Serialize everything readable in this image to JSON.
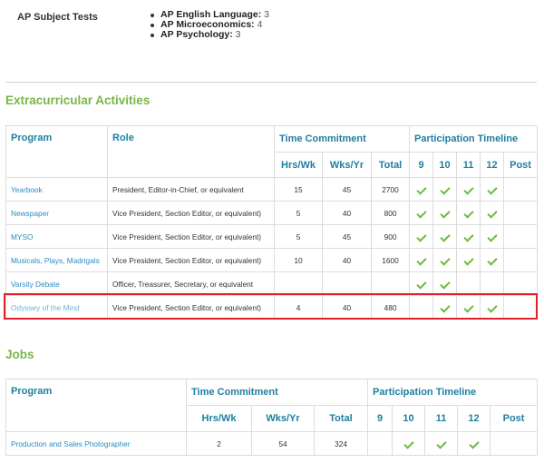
{
  "ap": {
    "label": "AP Subject Tests",
    "tests": [
      {
        "name": "AP English Language:",
        "score": "3"
      },
      {
        "name": "AP Microeconomics:",
        "score": "4"
      },
      {
        "name": "AP Psychology:",
        "score": "3"
      }
    ]
  },
  "extracurricular": {
    "title": "Extracurricular Activities",
    "headers": {
      "program": "Program",
      "role": "Role",
      "time": "Time Commitment",
      "timeline": "Participation Timeline",
      "hrs": "Hrs/Wk",
      "wks": "Wks/Yr",
      "total": "Total",
      "g9": "9",
      "g10": "10",
      "g11": "11",
      "g12": "12",
      "post": "Post"
    },
    "rows": [
      {
        "program": "Yearbook",
        "role": "President, Editor-in-Chief, or equivalent",
        "hrs": "15",
        "wks": "45",
        "total": "2700"
      },
      {
        "program": "Newspaper",
        "role": "Vice President, Section Editor, or equivalent)",
        "hrs": "5",
        "wks": "40",
        "total": "800"
      },
      {
        "program": "MYSO",
        "role": "Vice President, Section Editor, or equivalent)",
        "hrs": "5",
        "wks": "45",
        "total": "900"
      },
      {
        "program": "Musicals, Plays, Madrigals",
        "role": "Vice President, Section Editor, or equivalent)",
        "hrs": "10",
        "wks": "40",
        "total": "1600"
      },
      {
        "program": "Varsity Debate",
        "role": "Officer, Treasurer, Secretary, or equivalent",
        "hrs": "",
        "wks": "",
        "total": ""
      },
      {
        "program": "Odyssey of the Mind",
        "role": "Vice President, Section Editor, or equivalent)",
        "hrs": "4",
        "wks": "40",
        "total": "480"
      }
    ]
  },
  "jobs": {
    "title": "Jobs",
    "headers": {
      "program": "Program",
      "time": "Time Commitment",
      "timeline": "Participation Timeline",
      "hrs": "Hrs/Wk",
      "wks": "Wks/Yr",
      "total": "Total",
      "g9": "9",
      "g10": "10",
      "g11": "11",
      "g12": "12",
      "post": "Post"
    },
    "rows": [
      {
        "program": "Production and Sales Photographer",
        "hrs": "2",
        "wks": "54",
        "total": "324"
      }
    ]
  },
  "colors": {
    "section_title": "#7ab648",
    "header_text": "#1e7fa0",
    "link": "#2b8bbf",
    "check": "#6dbb3f",
    "highlight": "#e0202a"
  },
  "icons": {
    "participation_mark": "check-icon"
  }
}
